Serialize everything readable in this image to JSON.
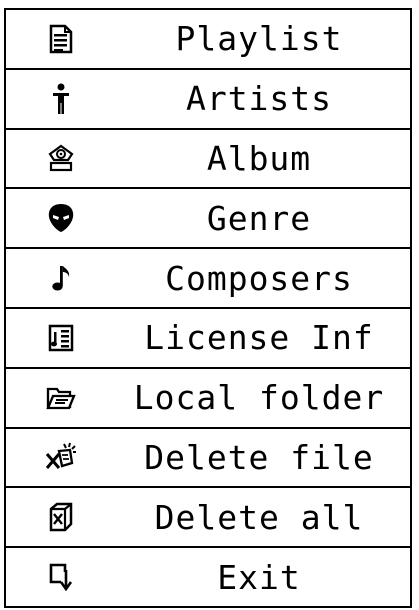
{
  "menu": {
    "items": [
      {
        "label": "Playlist",
        "icon": "playlist-icon"
      },
      {
        "label": "Artists",
        "icon": "artist-icon"
      },
      {
        "label": "Album",
        "icon": "album-icon"
      },
      {
        "label": "Genre",
        "icon": "genre-icon"
      },
      {
        "label": "Composers",
        "icon": "composer-icon"
      },
      {
        "label": "License Inf",
        "icon": "license-icon"
      },
      {
        "label": "Local folder",
        "icon": "folder-icon"
      },
      {
        "label": "Delete file",
        "icon": "delete-file-icon"
      },
      {
        "label": "Delete all",
        "icon": "delete-all-icon"
      },
      {
        "label": "Exit",
        "icon": "exit-icon"
      }
    ]
  }
}
